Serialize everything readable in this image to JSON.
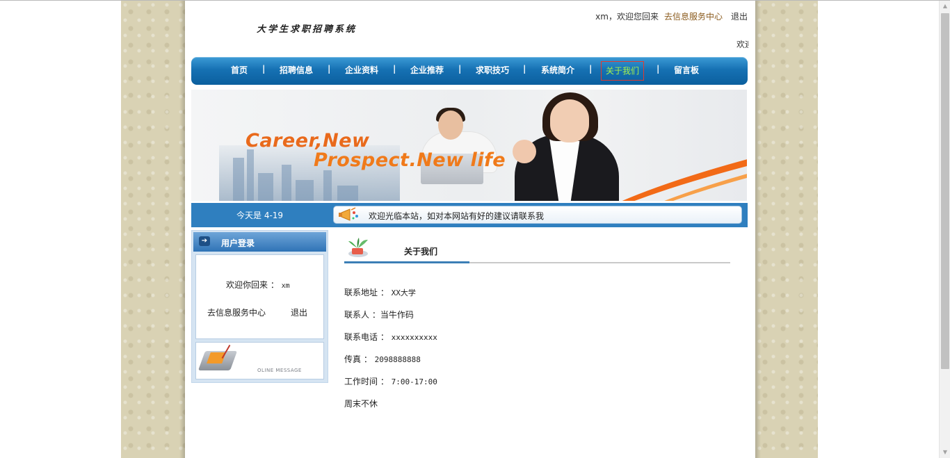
{
  "header": {
    "site_title": "大学生求职招聘系统",
    "username": "xm",
    "greeting_suffix": "，欢迎您回来",
    "service_link": "去信息服务中心",
    "logout": "退出",
    "marquee": "欢迎"
  },
  "nav": {
    "items": [
      "首页",
      "招聘信息",
      "企业资料",
      "企业推荐",
      "求职技巧",
      "系统简介",
      "关于我们",
      "留言板"
    ],
    "separator": "|",
    "active_index": 6
  },
  "banner": {
    "line1": "Career,New",
    "line2": "Prospect.New life"
  },
  "info_bar": {
    "date": "今天是 4-19",
    "notice": "欢迎光临本站，如对本网站有好的建议请联系我"
  },
  "login": {
    "title": "用户登录",
    "welcome_prefix": "欢迎你回来 ：",
    "username": "xm",
    "service_link": "去信息服务中心",
    "logout": "退出",
    "message_banner": "OLINE MESSAGE"
  },
  "about": {
    "title": "关于我们",
    "rows": [
      {
        "label": "联系地址 ：",
        "value": "XX大学"
      },
      {
        "label": "联系人 ：",
        "value": "当牛作码"
      },
      {
        "label": "联系电话 ：",
        "value": "xxxxxxxxxx"
      },
      {
        "label": "传真 ：",
        "value": "2098888888"
      },
      {
        "label": "工作时间 ：",
        "value": "7:00-17:00"
      },
      {
        "label": "周末不休",
        "value": ""
      }
    ]
  },
  "colors": {
    "nav_blue": "#1671b3",
    "active_nav_text": "#a6f24c",
    "active_nav_border": "#e23a2f",
    "slogan_orange": "#f07a1a",
    "link_brown": "#8a5a1c"
  }
}
